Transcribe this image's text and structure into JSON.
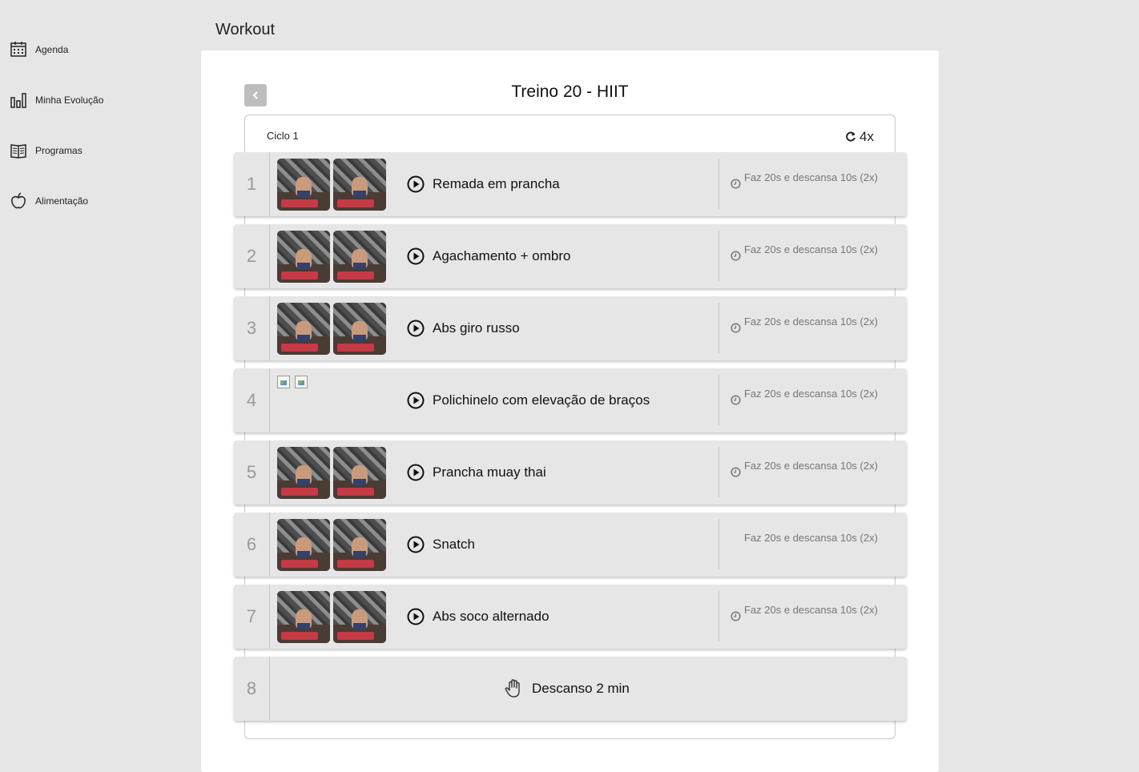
{
  "page": {
    "title": "Workout"
  },
  "sidebar": {
    "items": [
      {
        "label": "Agenda",
        "icon": "calendar-icon"
      },
      {
        "label": "Minha Evolução",
        "icon": "bar-chart-icon"
      },
      {
        "label": "Programas",
        "icon": "book-icon"
      },
      {
        "label": "Alimentação",
        "icon": "apple-icon"
      }
    ]
  },
  "workout": {
    "name": "Treino 20 - HIIT",
    "cycle": {
      "label": "Ciclo 1",
      "repeat": "4x"
    },
    "exercises": [
      {
        "number": "1",
        "name": "Remada em prancha",
        "timing": "Faz 20s e descansa 10s (2x)"
      },
      {
        "number": "2",
        "name": "Agachamento + ombro",
        "timing": "Faz 20s e descansa 10s (2x)"
      },
      {
        "number": "3",
        "name": "Abs giro russo",
        "timing": "Faz 20s e descansa 10s (2x)"
      },
      {
        "number": "4",
        "name": "Polichinelo com elevação de braços",
        "timing": "Faz 20s e descansa 10s (2x)"
      },
      {
        "number": "5",
        "name": "Prancha muay thai",
        "timing": "Faz 20s e descansa 10s (2x)"
      },
      {
        "number": "6",
        "name": "Snatch",
        "timing": "Faz 20s e descansa 10s (2x)"
      },
      {
        "number": "7",
        "name": "Abs soco alternado",
        "timing": "Faz 20s e descansa 10s (2x)"
      }
    ],
    "rest": {
      "number": "8",
      "label": "Descanso 2 min",
      "icon": "hand-icon"
    }
  },
  "colors": {
    "background": "#e6e6e6",
    "panel": "#ffffff",
    "row": "#e6e6e6",
    "muted_number": "#999999",
    "back_button": "#bdbdbd"
  }
}
